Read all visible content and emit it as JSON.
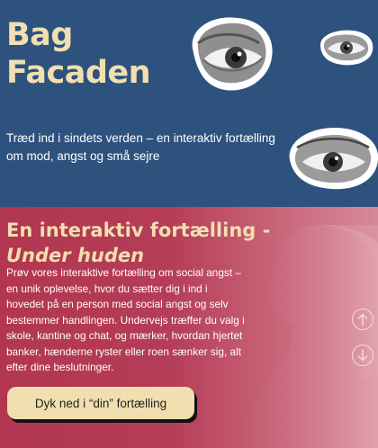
{
  "hero": {
    "title_line1": "Bag",
    "title_line2": "Facaden",
    "tagline": "Træd ind i sindets verden – en interaktiv fortælling om mod, angst og små sejre",
    "background": "#2e527e",
    "accent": "#f1dfb0"
  },
  "story": {
    "title": "En interaktiv fortælling -",
    "subtitle": "Under huden",
    "body": "Prøv vores interaktive fortælling om social angst – en unik oplevelse, hvor du sætter dig i ind i hovedet på en person med social angst og selv bestemmer handlingen. Undervejs træffer du valg i skole, kantine og chat, og mærker, hvordan hjertet banker, hænderne ryster eller roen sænker sig, alt efter dine beslutninger.",
    "cta_label": "Dyk ned i “din” fortælling",
    "background": "#b2364f"
  },
  "icons": {
    "scroll_up": "arrow-up-icon",
    "scroll_down": "arrow-down-icon"
  }
}
